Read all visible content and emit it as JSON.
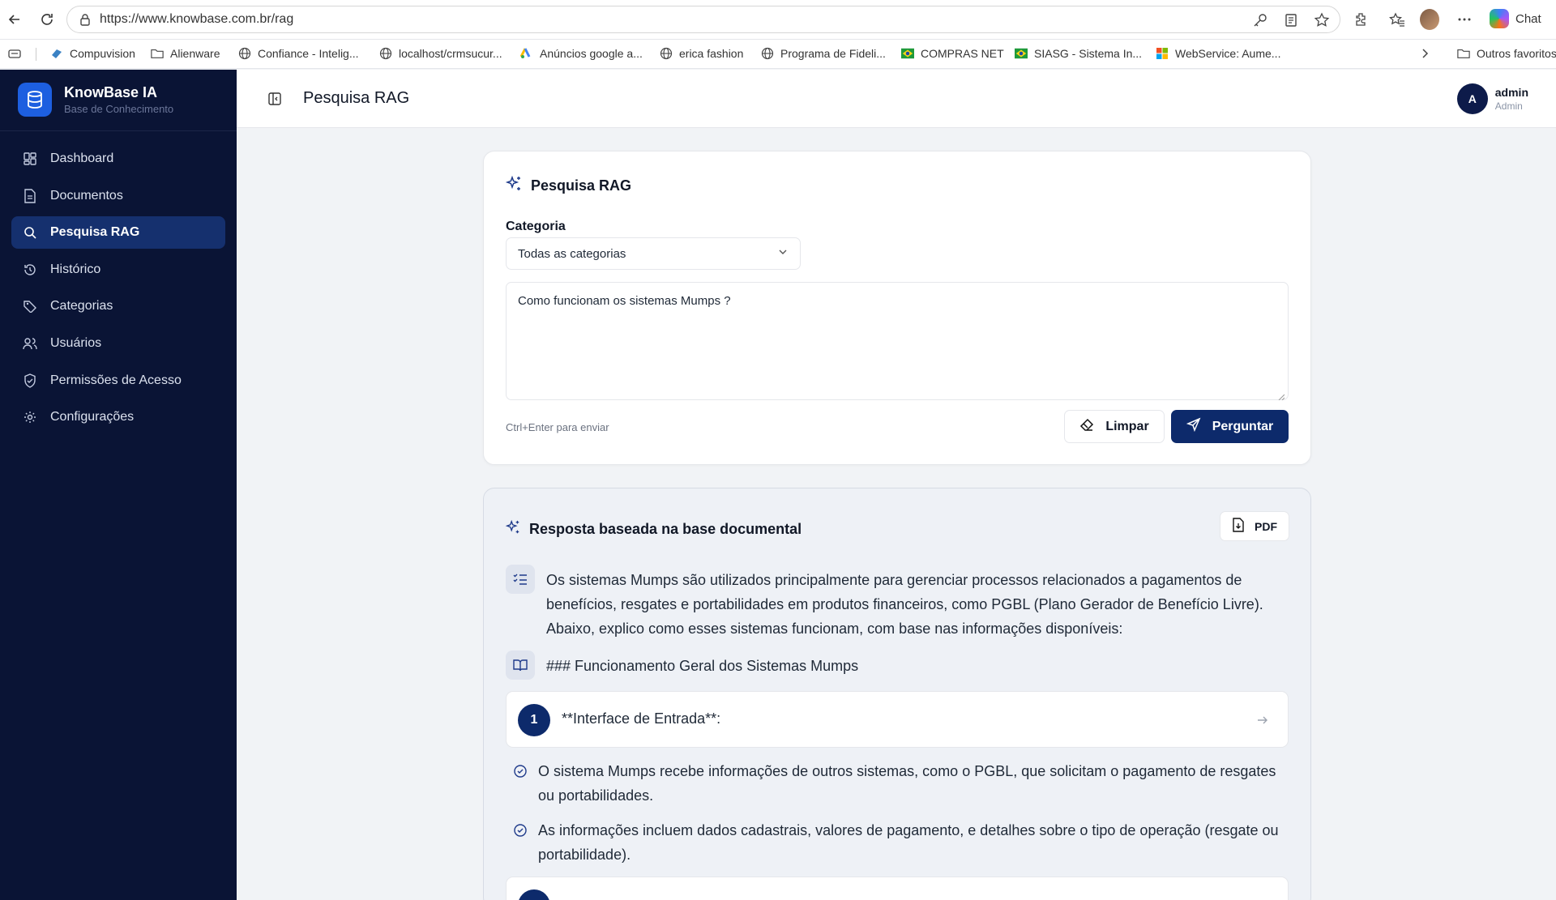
{
  "browser": {
    "url": "https://www.knowbase.com.br/rag",
    "chat_label": "Chat",
    "bookmarks": [
      {
        "label": "Compuvision",
        "icon": "compuvision-icon"
      },
      {
        "label": "Alienware",
        "icon": "folder-icon"
      },
      {
        "label": "Confiance - Intelig...",
        "icon": "globe-icon"
      },
      {
        "label": "localhost/crmsucur...",
        "icon": "globe-icon"
      },
      {
        "label": "Anúncios google a...",
        "icon": "google-ads-icon"
      },
      {
        "label": "erica fashion",
        "icon": "globe-icon"
      },
      {
        "label": "Programa de Fideli...",
        "icon": "globe-icon"
      },
      {
        "label": "COMPRAS NET",
        "icon": "flag-br-icon"
      },
      {
        "label": "SIASG - Sistema In...",
        "icon": "flag-br-icon"
      },
      {
        "label": "WebService: Aume...",
        "icon": "microsoft-icon"
      }
    ],
    "other_favorites": "Outros favoritos"
  },
  "sidebar": {
    "brand_name": "KnowBase IA",
    "brand_sub": "Base de Conhecimento",
    "items": [
      {
        "label": "Dashboard",
        "icon": "dashboard-icon",
        "active": false
      },
      {
        "label": "Documentos",
        "icon": "document-icon",
        "active": false
      },
      {
        "label": "Pesquisa RAG",
        "icon": "search-icon",
        "active": true
      },
      {
        "label": "Histórico",
        "icon": "history-icon",
        "active": false
      },
      {
        "label": "Categorias",
        "icon": "tag-icon",
        "active": false
      },
      {
        "label": "Usuários",
        "icon": "users-icon",
        "active": false
      },
      {
        "label": "Permissões de Acesso",
        "icon": "shield-icon",
        "active": false
      },
      {
        "label": "Configurações",
        "icon": "gear-icon",
        "active": false
      }
    ]
  },
  "header": {
    "title": "Pesquisa RAG",
    "user_initial": "A",
    "user_name": "admin",
    "user_role": "Admin"
  },
  "search": {
    "title": "Pesquisa RAG",
    "category_label": "Categoria",
    "category_value": "Todas as categorias",
    "query": "Como funcionam os sistemas Mumps ?",
    "hint": "Ctrl+Enter para enviar",
    "clear_label": "Limpar",
    "ask_label": "Perguntar"
  },
  "answer": {
    "title": "Resposta baseada na base documental",
    "pdf_label": "PDF",
    "intro": "Os sistemas Mumps são utilizados principalmente para gerenciar processos relacionados a pagamentos de benefícios, resgates e portabilidades em produtos financeiros, como PGBL (Plano Gerador de Benefício Livre). Abaixo, explico como esses sistemas funcionam, com base nas informações disponíveis:",
    "heading": "### Funcionamento Geral dos Sistemas Mumps",
    "steps": [
      {
        "num": "1",
        "text": "**Interface de Entrada**:"
      }
    ],
    "bullets": [
      "O sistema Mumps recebe informações de outros sistemas, como o PGBL, que solicitam o pagamento de resgates ou portabilidades.",
      "As informações incluem dados cadastrais, valores de pagamento, e detalhes sobre o tipo de operação (resgate ou portabilidade)."
    ]
  }
}
